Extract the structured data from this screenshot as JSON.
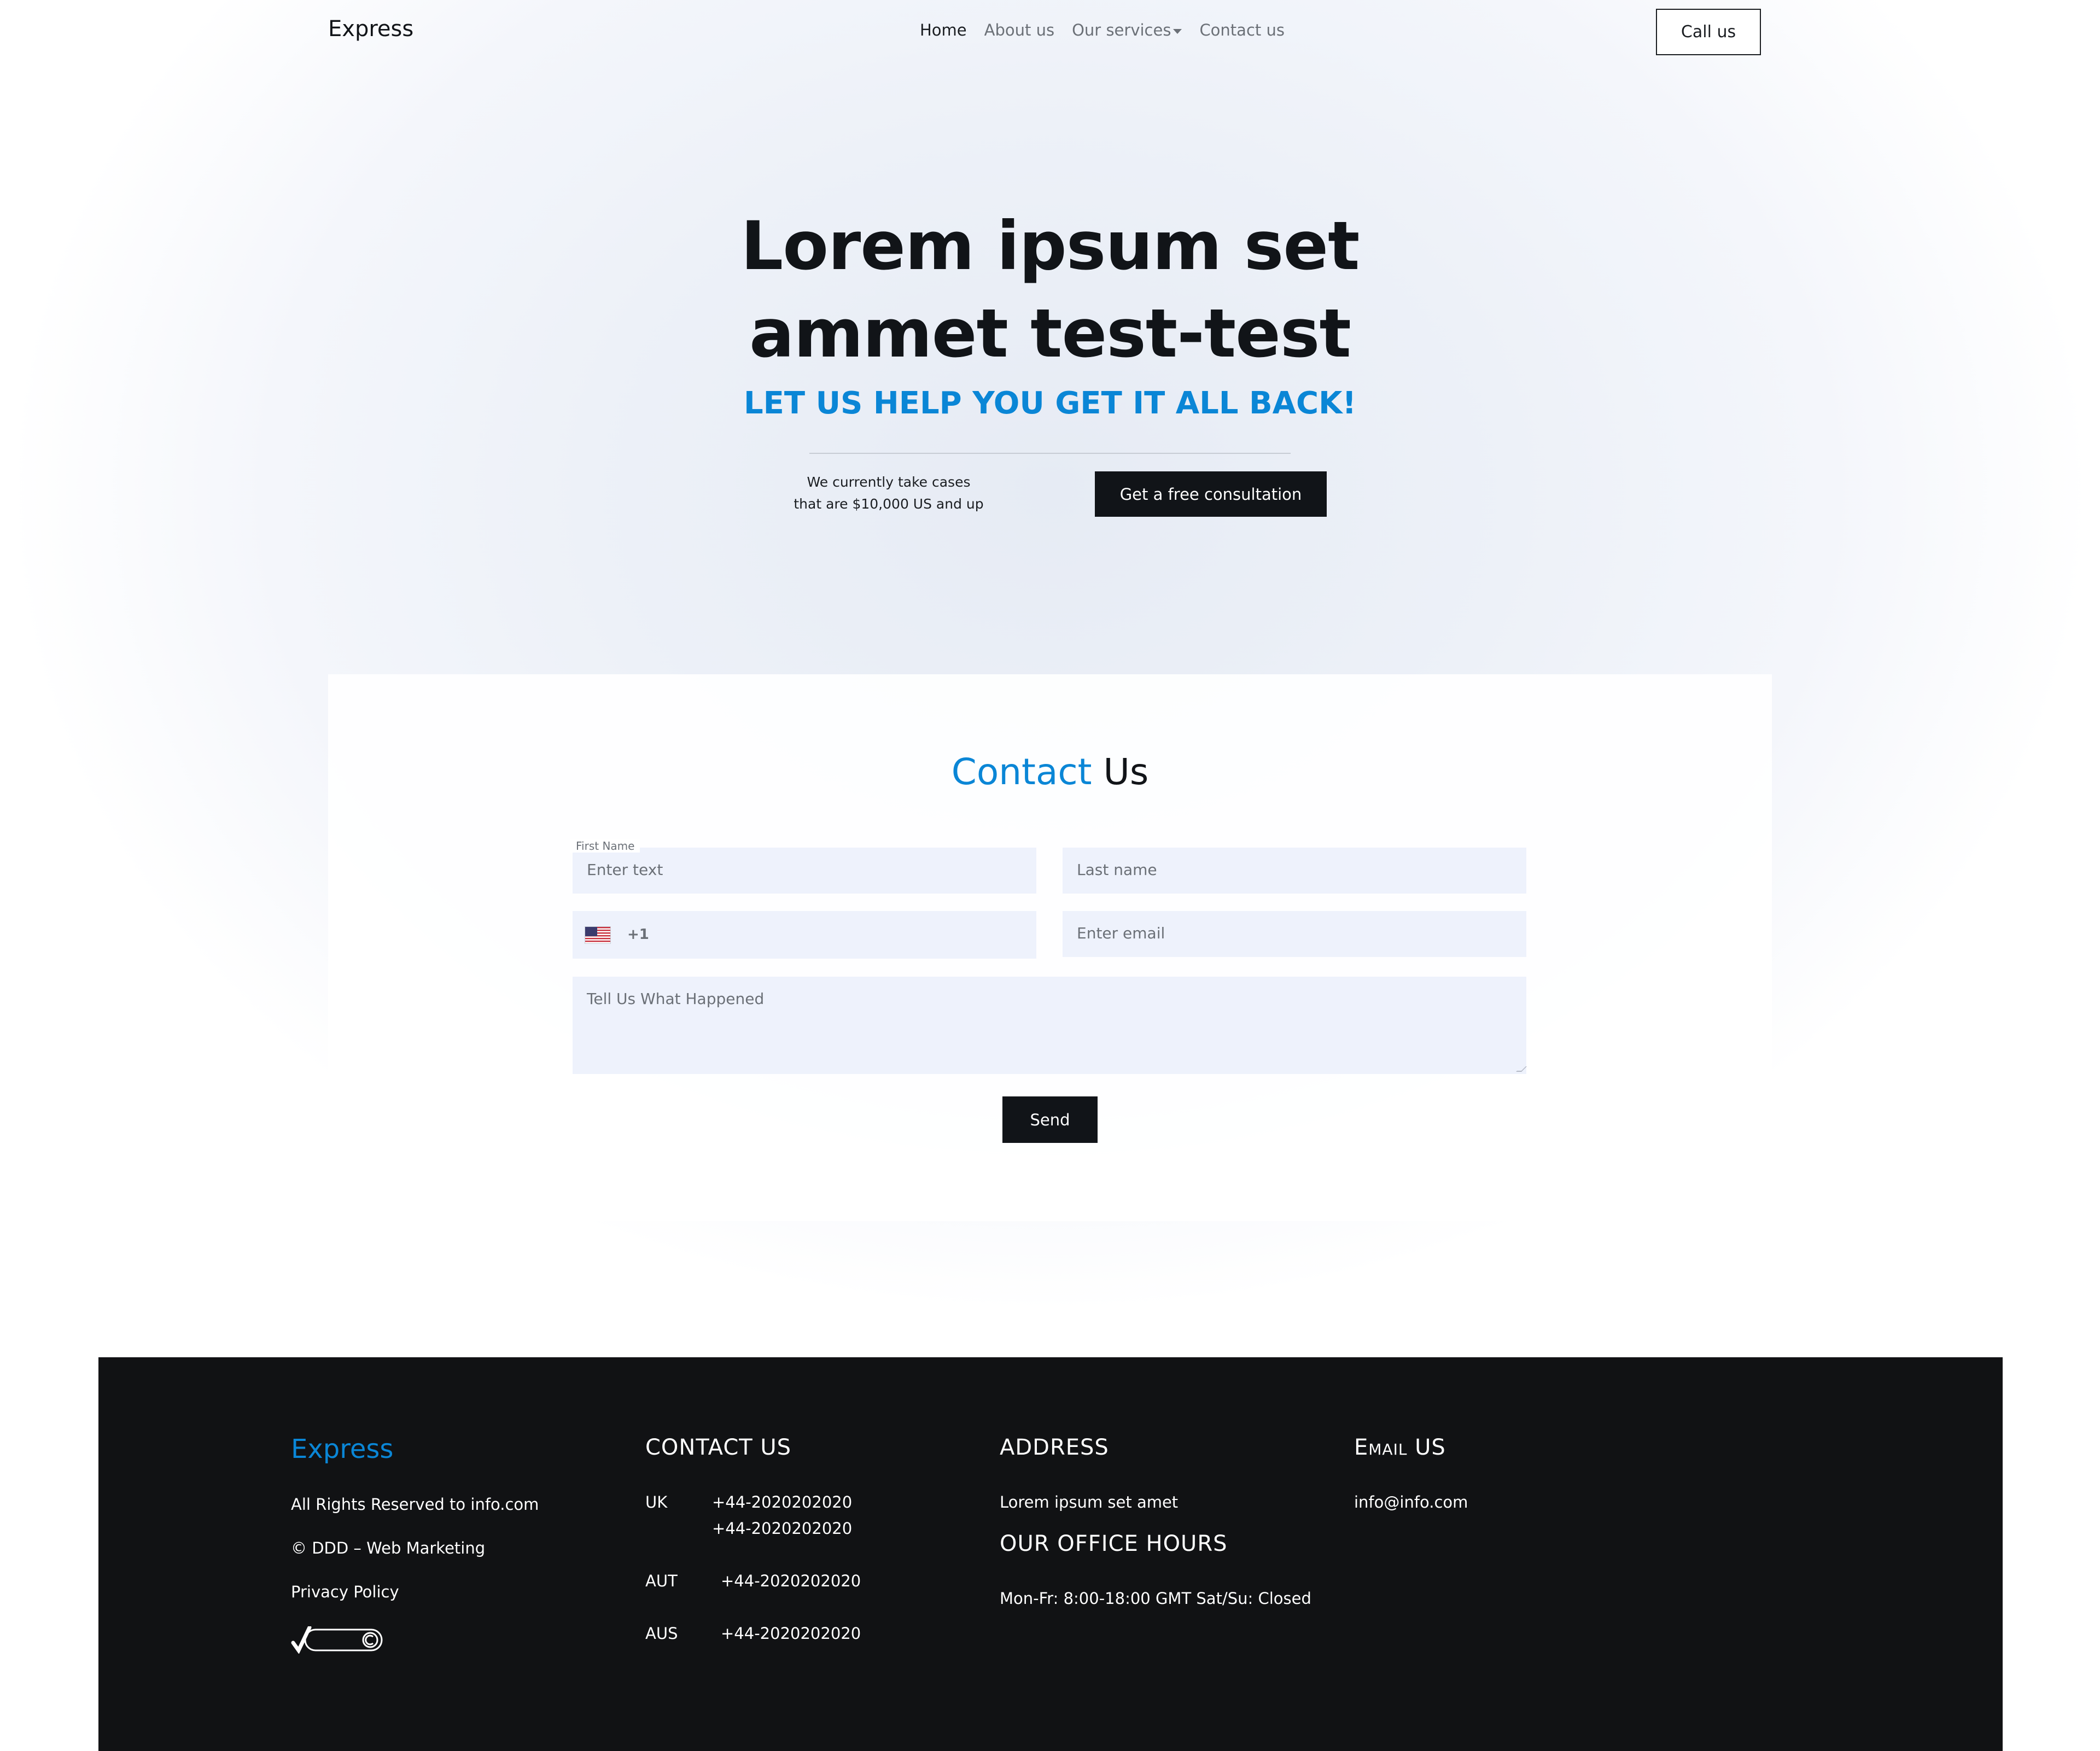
{
  "nav": {
    "brand": "Express",
    "items": [
      {
        "label": "Home",
        "active": true
      },
      {
        "label": "About us",
        "active": false
      },
      {
        "label": "Our services",
        "active": false
      },
      {
        "label": "Contact us",
        "active": false
      }
    ],
    "cta": "Call us"
  },
  "hero": {
    "title_line1": "Lorem ipsum set",
    "title_line2": "ammet test-test",
    "subtitle": "LET US HELP YOU GET IT ALL BACK!",
    "note_line1": "We currently take cases",
    "note_line2": "that are $10,000 US and up",
    "cta": "Get a free consultation"
  },
  "contact": {
    "title_accent": "Contact",
    "title_rest": "Us",
    "first_name_label": "First Name",
    "first_name_placeholder": "Enter text",
    "last_name_placeholder": "Last name",
    "phone_dial_code": "+1",
    "email_placeholder": "Enter email",
    "message_placeholder": "Tell Us What Happened",
    "send": "Send"
  },
  "footer": {
    "brand": "Express",
    "rights": "All Rights Reserved to info.com",
    "copyright": "© DDD – Web Marketing",
    "privacy": "Privacy Policy",
    "dmca_badge": "DMCA.com COMPLIANT",
    "contact_heading": "CONTACT US",
    "phones": [
      {
        "country": "UK",
        "number": "+44-2020202020",
        "number2": "+44-2020202020"
      },
      {
        "country": "AUT",
        "number": "+44-2020202020"
      },
      {
        "country": "AUS",
        "number": "+44-2020202020"
      }
    ],
    "address_heading": "ADDRESS",
    "address": "Lorem ipsum set amet",
    "hours_heading": "OUR OFFICE HOURS",
    "hours": "Mon-Fr: 8:00-18:00 GMT Sat/Su: Closed",
    "email_heading": "Email US",
    "email": "info@info.com"
  },
  "colors": {
    "accent": "#0a86d6",
    "dark": "#111418",
    "input_bg": "#eef2fc",
    "footer_bg": "#111214"
  }
}
